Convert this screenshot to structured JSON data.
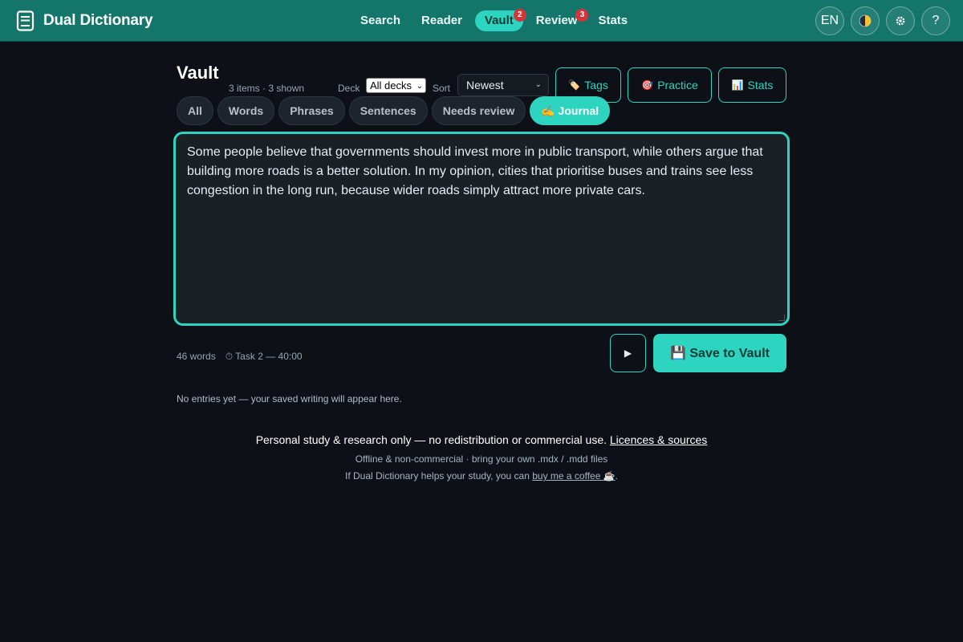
{
  "app": {
    "name": "Dual Dictionary",
    "icon": "book-icon"
  },
  "nav": {
    "items": [
      {
        "label": "Search",
        "active": false,
        "badge": null
      },
      {
        "label": "Reader",
        "active": false,
        "badge": null
      },
      {
        "label": "Vault",
        "active": true,
        "badge": "2"
      },
      {
        "label": "Review",
        "active": false,
        "badge": "3"
      },
      {
        "label": "Stats",
        "active": false,
        "badge": null
      }
    ]
  },
  "header_buttons": {
    "language": "EN",
    "theme_icon": "theme-toggle-icon",
    "settings_icon": "gear-icon",
    "help": "?"
  },
  "vault": {
    "title": "Vault",
    "count": "3 items · 3 shown",
    "deck_label": "Deck",
    "deck_value": "All decks",
    "sort_label": "Sort",
    "sort_value": "Newest",
    "tools": [
      {
        "icon": "🏷️",
        "label": "Tags"
      },
      {
        "icon": "🎯",
        "label": "Practice"
      },
      {
        "icon": "📊",
        "label": "Stats"
      }
    ]
  },
  "tabs": [
    {
      "label": "All",
      "active": false
    },
    {
      "label": "Words",
      "active": false
    },
    {
      "label": "Phrases",
      "active": false
    },
    {
      "label": "Sentences",
      "active": false
    },
    {
      "label": "Needs review",
      "active": false
    },
    {
      "label": "✍️ Journal",
      "active": true
    }
  ],
  "journal": {
    "text": "Some people believe that governments should invest more in public transport, while others argue that building more roads is a better solution. In my opinion, cities that prioritise buses and trains see less congestion in the long run, because wider roads simply attract more private cars.",
    "word_count": "46 words",
    "task_timer": "⏱ Task 2 — 40:00",
    "play_label": "▶",
    "save_label": "💾 Save to Vault",
    "empty_message": "No entries yet — your saved writing will appear here."
  },
  "footer": {
    "line1_text": "Personal study & research only — no redistribution or commercial use.",
    "line1_link": "Licences & sources",
    "line2": "Offline & non-commercial · bring your own .mdx / .mdd files",
    "line3_prefix": "If Dual Dictionary helps your study, you can",
    "line3_link": "buy me a coffee ☕",
    "line3_suffix": "."
  },
  "colors": {
    "header": "#14756b",
    "accent": "#2dd4bf",
    "background": "#0d1117",
    "badge": "#d6343a"
  }
}
